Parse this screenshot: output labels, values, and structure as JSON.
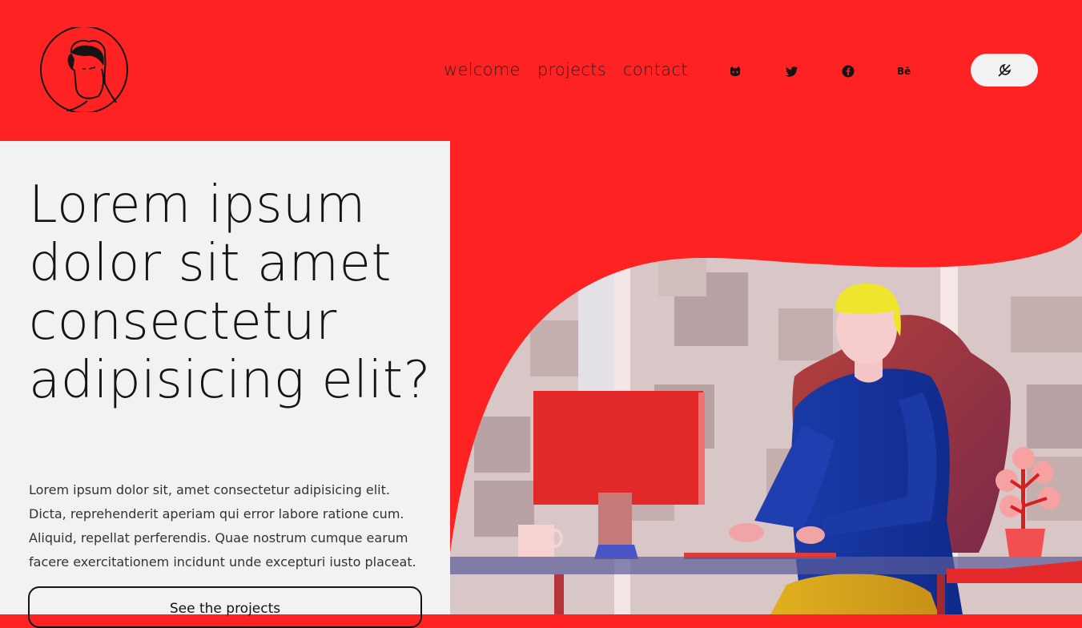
{
  "header": {
    "nav": [
      {
        "label": "welcome"
      },
      {
        "label": "projects"
      },
      {
        "label": "contact"
      }
    ],
    "social_icons": [
      "github-icon",
      "twitter-icon",
      "facebook-icon",
      "behance-icon"
    ],
    "behance_label": "Bē",
    "theme_toggle_icon": "dark-mode-icon"
  },
  "hero": {
    "title": "Lorem ipsum dolor sit amet consectetur adipisicing elit?",
    "paragraph": "Lorem ipsum dolor sit, amet consectetur adipisicing elit. Dicta, reprehenderit aperiam qui error labore ratione cum. Aliquid, repellat perferendis. Quae nostrum cumque earum facere exercitationem incidunt unde excepturi iusto placeat.",
    "cta_label": "See the projects"
  },
  "colors": {
    "accent": "#ff2222",
    "panel": "#f2f2f2",
    "text": "#141414"
  }
}
